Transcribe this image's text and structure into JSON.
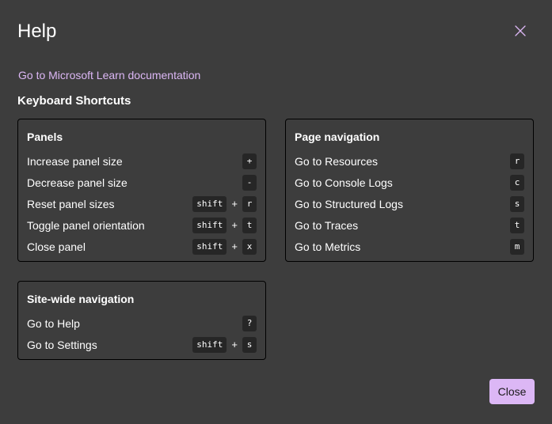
{
  "dialog": {
    "title": "Help",
    "learn_link": "Go to Microsoft Learn documentation",
    "section_heading": "Keyboard Shortcuts",
    "close_button_label": "Close"
  },
  "panels": {
    "panels": {
      "title": "Panels",
      "rows": [
        {
          "label": "Increase panel size",
          "keys": [
            "+"
          ]
        },
        {
          "label": "Decrease panel size",
          "keys": [
            "-"
          ]
        },
        {
          "label": "Reset panel sizes",
          "keys": [
            "shift",
            "r"
          ]
        },
        {
          "label": "Toggle panel orientation",
          "keys": [
            "shift",
            "t"
          ]
        },
        {
          "label": "Close panel",
          "keys": [
            "shift",
            "x"
          ]
        }
      ]
    },
    "page_navigation": {
      "title": "Page navigation",
      "rows": [
        {
          "label": "Go to Resources",
          "keys": [
            "r"
          ]
        },
        {
          "label": "Go to Console Logs",
          "keys": [
            "c"
          ]
        },
        {
          "label": "Go to Structured Logs",
          "keys": [
            "s"
          ]
        },
        {
          "label": "Go to Traces",
          "keys": [
            "t"
          ]
        },
        {
          "label": "Go to Metrics",
          "keys": [
            "m"
          ]
        }
      ]
    },
    "site_wide": {
      "title": "Site-wide navigation",
      "rows": [
        {
          "label": "Go to Help",
          "keys": [
            "?"
          ]
        },
        {
          "label": "Go to Settings",
          "keys": [
            "shift",
            "s"
          ]
        }
      ]
    }
  },
  "key_separator": "+",
  "colors": {
    "background": "#3d3d3d",
    "accent": "#dcb7f5",
    "kbd_background": "#262626",
    "panel_border": "#000000"
  },
  "icons": {
    "close": "close-icon"
  }
}
